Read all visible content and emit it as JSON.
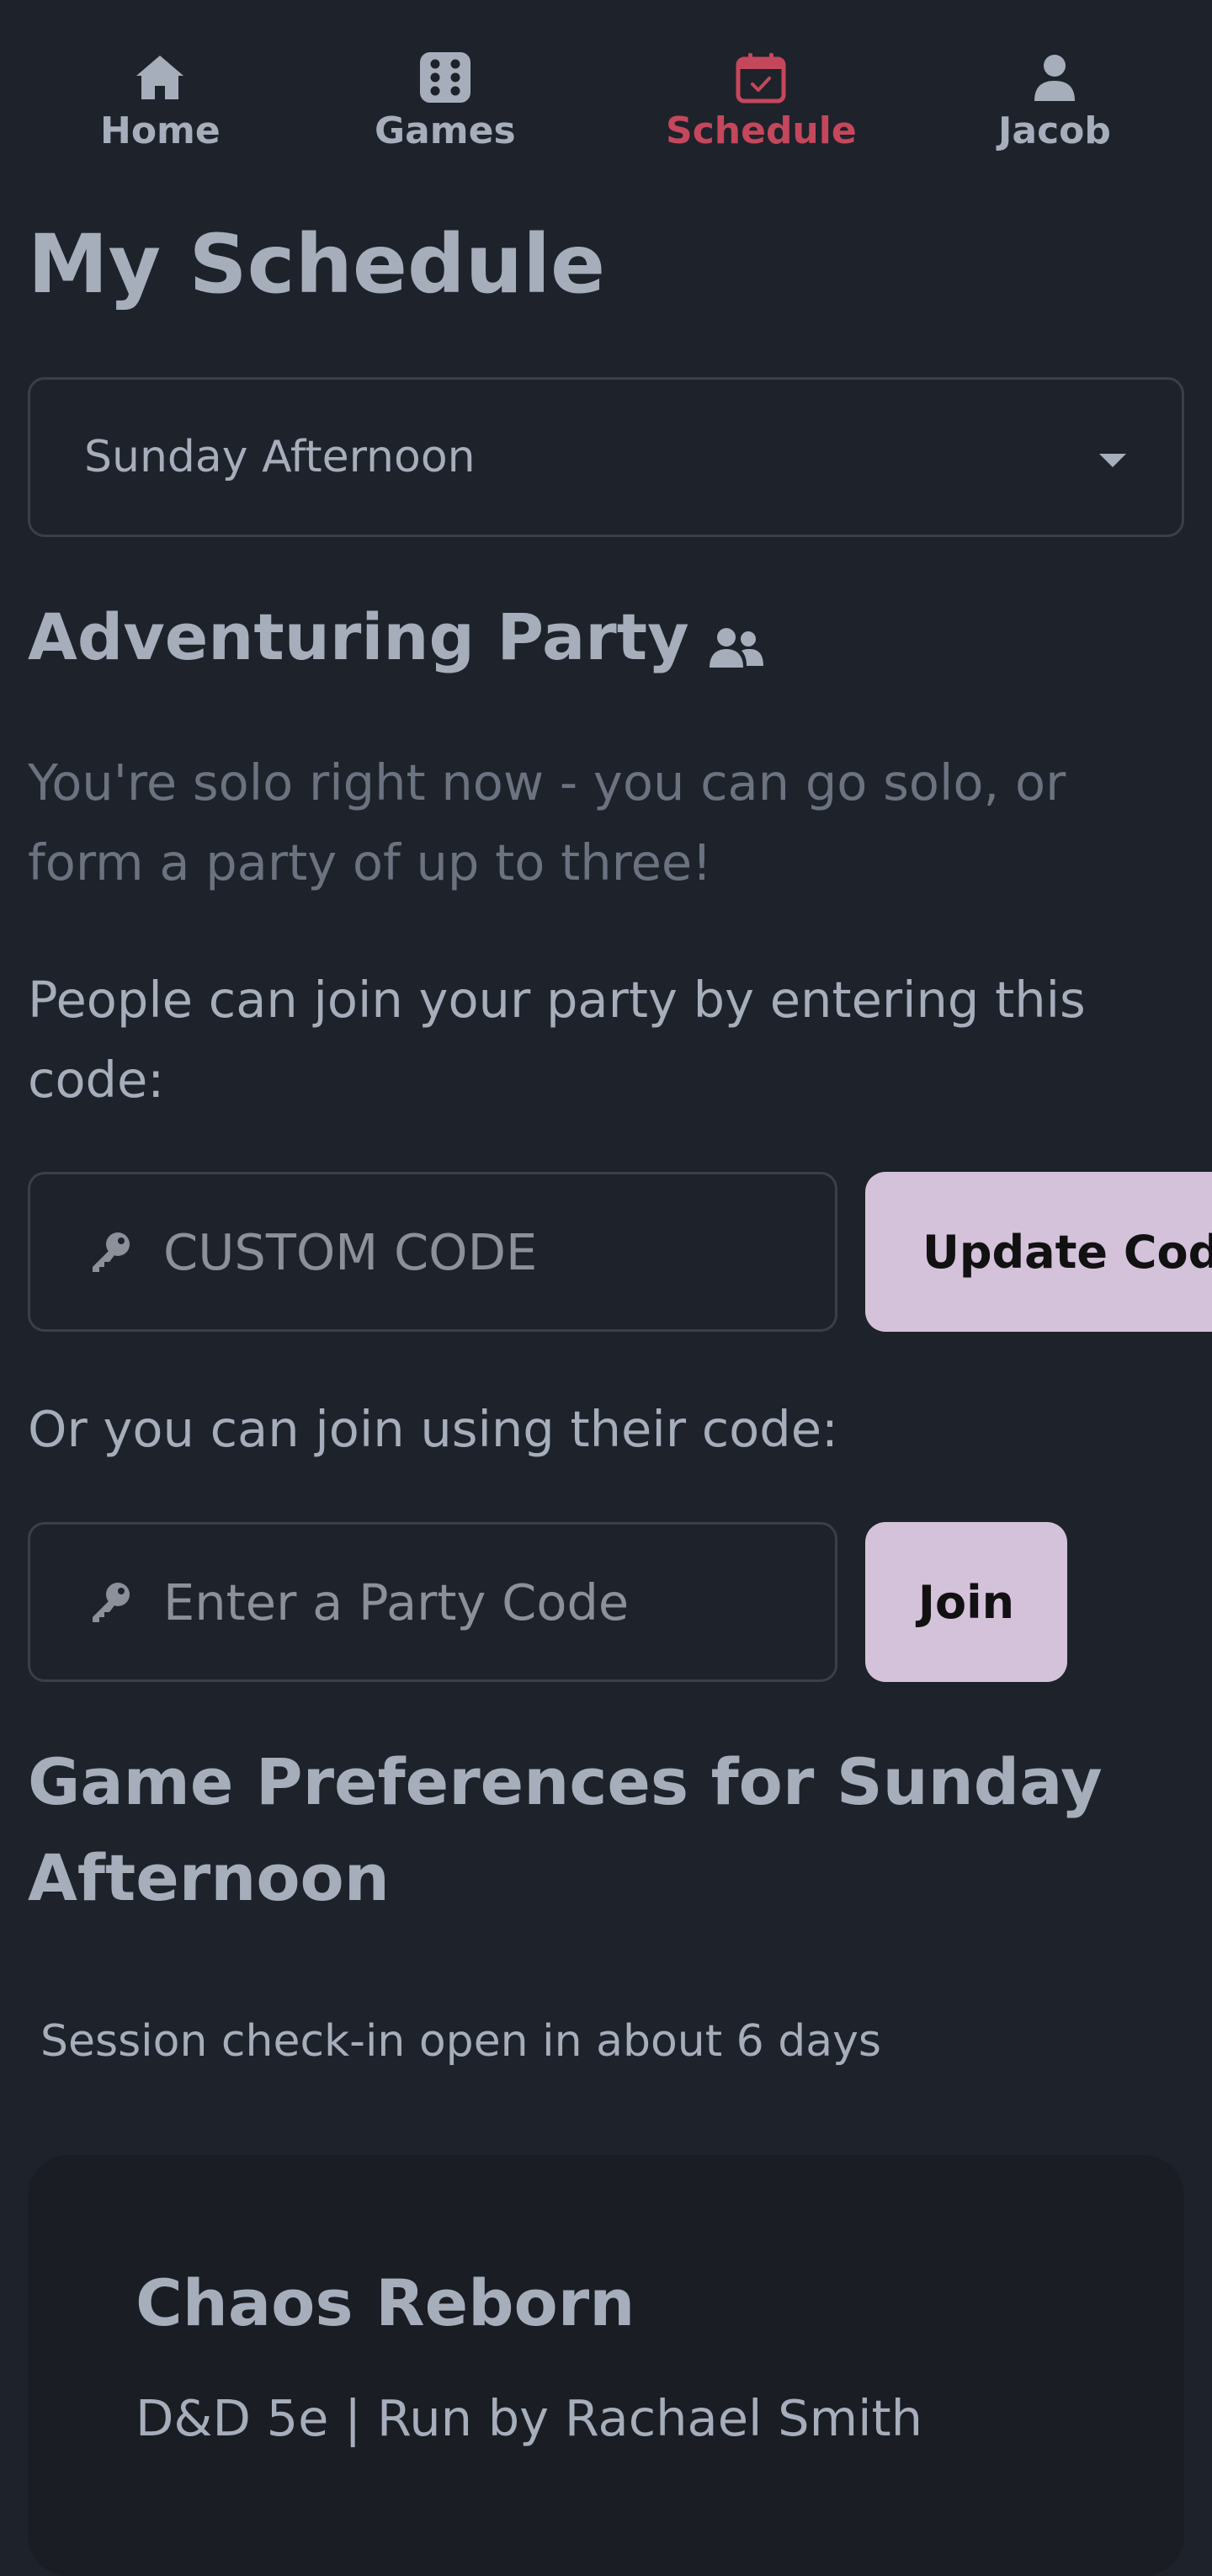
{
  "nav": {
    "items": [
      {
        "label": "Home",
        "icon": "home-icon"
      },
      {
        "label": "Games",
        "icon": "dice-icon"
      },
      {
        "label": "Schedule",
        "icon": "calendar-check-icon",
        "active": true
      },
      {
        "label": "Jacob",
        "icon": "user-icon"
      }
    ],
    "active_color": "#c5475c"
  },
  "page": {
    "title": "My Schedule"
  },
  "session_select": {
    "selected": "Sunday Afternoon"
  },
  "party": {
    "heading": "Adventuring Party",
    "solo_text": "You're solo right now - you can go solo, or form a party of up to three!",
    "join_info": "People can join your party by entering this code:",
    "custom_code_placeholder": "CUSTOM CODE",
    "update_button": "Update Code",
    "or_text": "Or you can join using their code:",
    "join_placeholder": "Enter a Party Code",
    "join_button": "Join"
  },
  "preferences": {
    "heading": "Game Preferences for Sunday Afternoon",
    "checkin_text": "Session check-in open in about 6 days"
  },
  "games": [
    {
      "title": "Chaos Reborn",
      "meta": "D&D 5e | Run by Rachael Smith"
    }
  ],
  "colors": {
    "background": "#1e222a",
    "text": "#a6adbb",
    "muted_text": "#6b7280",
    "button": "#d4c1da",
    "card": "#1a1d24"
  }
}
